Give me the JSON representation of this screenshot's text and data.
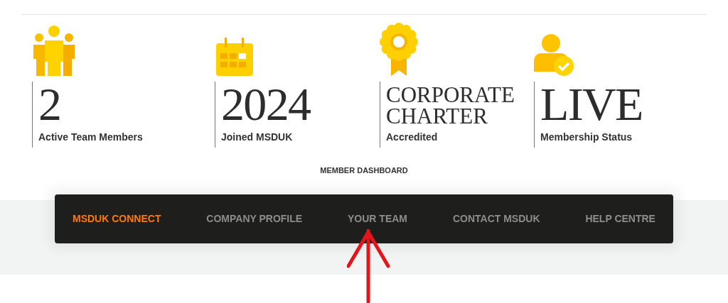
{
  "stats": [
    {
      "value_lines": [
        "2"
      ],
      "label": "Active Team Members"
    },
    {
      "value_lines": [
        "2024"
      ],
      "label": "Joined MSDUK"
    },
    {
      "value_lines": [
        "CORPORATE",
        "CHARTER"
      ],
      "label": "Accredited"
    },
    {
      "value_lines": [
        "LIVE"
      ],
      "label": "Membership Status"
    }
  ],
  "dashboard": {
    "title": "MEMBER DASHBOARD",
    "nav": [
      {
        "label": "MSDUK CONNECT",
        "selected": true
      },
      {
        "label": "COMPANY PROFILE",
        "selected": false
      },
      {
        "label": "YOUR TEAM",
        "selected": false
      },
      {
        "label": "CONTACT MSDUK",
        "selected": false
      },
      {
        "label": "HELP CENTRE",
        "selected": false
      }
    ]
  }
}
